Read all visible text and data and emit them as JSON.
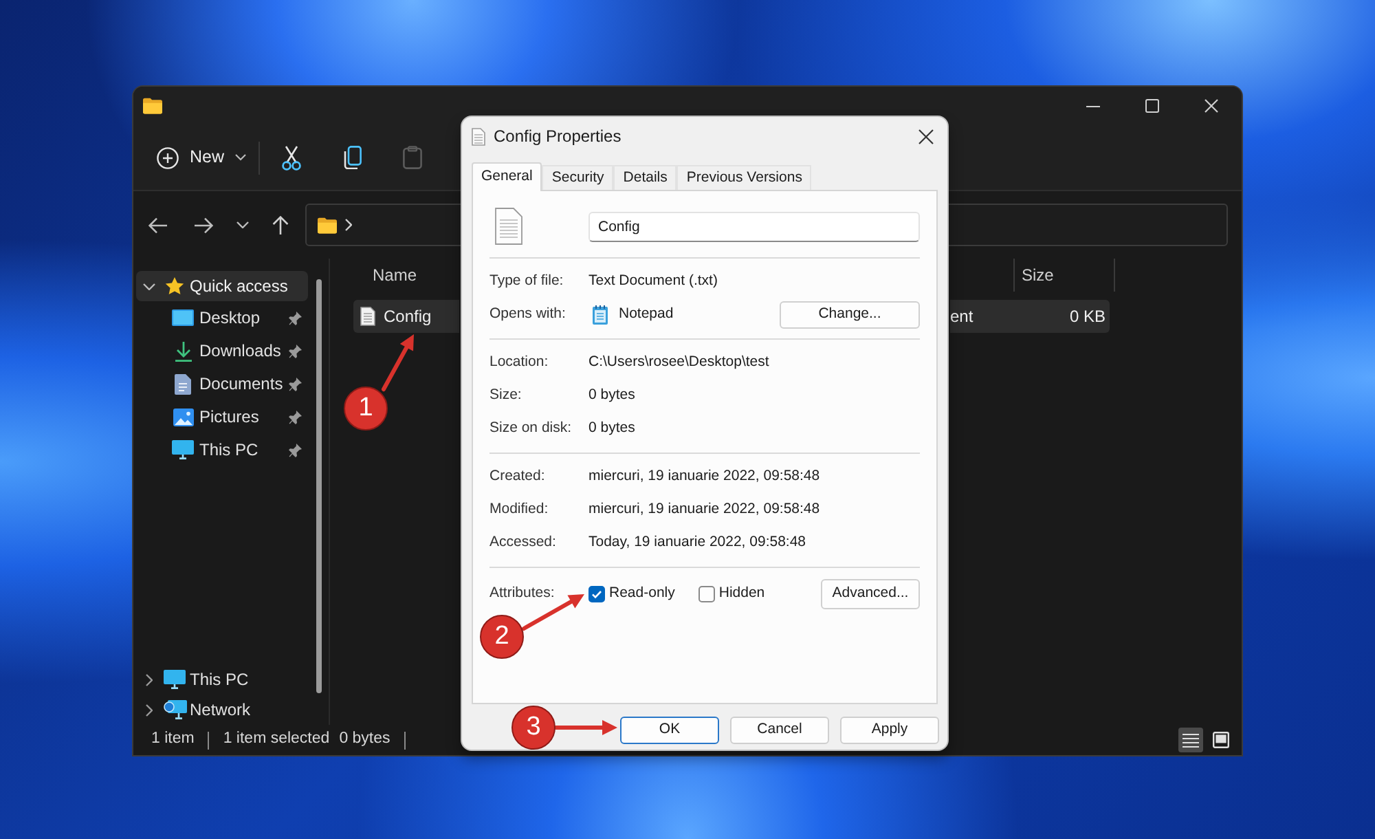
{
  "explorer": {
    "toolbar": [
      {
        "kind": "new",
        "label": "New",
        "disabled": false
      },
      {
        "kind": "cut",
        "disabled": false
      },
      {
        "kind": "copy",
        "disabled": false
      },
      {
        "kind": "paste",
        "disabled": true
      }
    ],
    "sidebar": {
      "items": [
        {
          "label": "Quick access",
          "kind": "star",
          "selected": true,
          "expanded": true,
          "children": [
            {
              "label": "Desktop",
              "kind": "desktop",
              "selected": false,
              "pinned": true
            },
            {
              "label": "Downloads",
              "kind": "downloads",
              "selected": false,
              "pinned": true
            },
            {
              "label": "Documents",
              "kind": "documents",
              "selected": false,
              "pinned": true
            },
            {
              "label": "Pictures",
              "kind": "pictures",
              "selected": false,
              "pinned": true
            },
            {
              "label": "This PC",
              "kind": "pc",
              "selected": false,
              "pinned": true
            }
          ]
        },
        {
          "label": "This PC",
          "kind": "pc",
          "selected": false,
          "expanded": false
        },
        {
          "label": "Network",
          "kind": "network",
          "selected": false,
          "expanded": false
        }
      ]
    },
    "table": {
      "columns": [
        {
          "label": "Name"
        },
        {
          "label": "Size"
        }
      ],
      "rows": [
        {
          "name": "Config",
          "column_2": "ent",
          "size": "0 KB",
          "selected": true
        }
      ]
    },
    "status_bar": [
      {
        "text": "1 item",
        "divider": true
      },
      {
        "text": "1 item selected",
        "divider": false
      },
      {
        "text": "0 bytes",
        "divider": true
      }
    ],
    "views": [
      {
        "kind": "details",
        "selected": true
      },
      {
        "kind": "tiles",
        "selected": false
      }
    ]
  },
  "dialog": {
    "title": "Config Properties",
    "tabs": [
      {
        "label": "General",
        "selected": true
      },
      {
        "label": "Security",
        "selected": false
      },
      {
        "label": "Details",
        "selected": false
      },
      {
        "label": "Previous Versions",
        "selected": false
      }
    ],
    "file_name": "Config",
    "sections": [
      [
        {
          "kind": "text",
          "label": "Type of file:",
          "value": "Text Document (.txt)"
        },
        {
          "kind": "app",
          "label": "Opens with:",
          "value": "Notepad",
          "button": "Change..."
        }
      ],
      [
        {
          "kind": "text",
          "label": "Location:",
          "value": "C:\\Users\\rosee\\Desktop\\test"
        },
        {
          "kind": "text",
          "label": "Size:",
          "value": "0 bytes"
        },
        {
          "kind": "text",
          "label": "Size on disk:",
          "value": "0 bytes"
        }
      ],
      [
        {
          "kind": "text",
          "label": "Created:",
          "value": "miercuri, 19 ianuarie 2022, 09:58:48"
        },
        {
          "kind": "text",
          "label": "Modified:",
          "value": "miercuri, 19 ianuarie 2022, 09:58:48"
        },
        {
          "kind": "text",
          "label": "Accessed:",
          "value": "Today, 19 ianuarie 2022, 09:58:48"
        }
      ]
    ],
    "attributes": {
      "label": "Attributes:",
      "checkboxes": [
        {
          "label": "Read-only",
          "checked": true
        },
        {
          "label": "Hidden",
          "checked": false
        }
      ],
      "button": "Advanced..."
    },
    "buttons": [
      {
        "label": "OK",
        "default": true
      },
      {
        "label": "Cancel",
        "default": false
      },
      {
        "label": "Apply",
        "default": false
      }
    ]
  },
  "annotations": [
    {
      "number": "1"
    },
    {
      "number": "2"
    },
    {
      "number": "3"
    }
  ]
}
